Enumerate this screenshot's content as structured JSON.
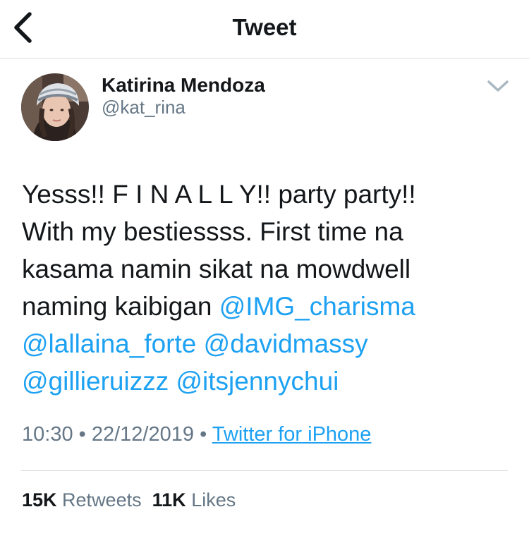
{
  "header": {
    "title": "Tweet",
    "back_icon": "chevron-left-icon"
  },
  "author": {
    "name": "Katirina Mendoza",
    "handle": "@kat_rina",
    "more_icon": "chevron-down-icon"
  },
  "tweet": {
    "lines": [
      [
        {
          "text": "Yesss!! F I N A L L Y!! party party!!",
          "mention": false
        }
      ],
      [
        {
          "text": "With my bestiessss. First time na",
          "mention": false
        }
      ],
      [
        {
          "text": "kasama namin sikat na mowdwell",
          "mention": false
        }
      ],
      [
        {
          "text": "naming kaibigan ",
          "mention": false
        },
        {
          "text": "@IMG_charisma",
          "mention": true
        }
      ],
      [
        {
          "text": "@lallaina_forte",
          "mention": true
        },
        {
          "text": " ",
          "mention": false
        },
        {
          "text": "@davidmassy",
          "mention": true
        }
      ],
      [
        {
          "text": "@gillieruizzz",
          "mention": true
        },
        {
          "text": " ",
          "mention": false
        },
        {
          "text": "@itsjennychui",
          "mention": true
        }
      ]
    ]
  },
  "meta": {
    "time": "10:30",
    "separator": " • ",
    "date": "22/12/2019",
    "source": "Twitter for iPhone"
  },
  "stats": {
    "retweets_count": "15K",
    "retweets_label": "Retweets",
    "likes_count": "11K",
    "likes_label": "Likes"
  },
  "colors": {
    "accent": "#1da1f2",
    "text": "#14171a",
    "secondary": "#657786",
    "divider": "#d9dde0"
  }
}
